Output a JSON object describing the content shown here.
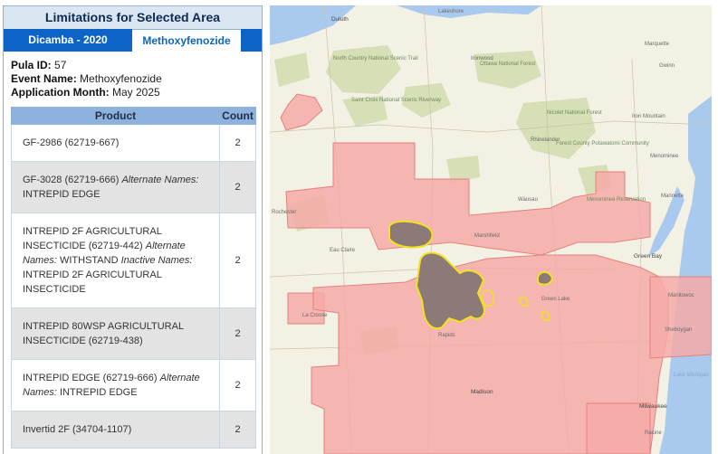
{
  "panel": {
    "title": "Limitations for Selected Area",
    "tabs": [
      {
        "label": "Dicamba - 2020",
        "active": false
      },
      {
        "label": "Methoxyfenozide",
        "active": true
      }
    ],
    "pula_id_label": "Pula ID:",
    "pula_id": "57",
    "event_name_label": "Event Name:",
    "event_name": "Methoxyfenozide",
    "app_month_label": "Application Month:",
    "app_month": "May 2025",
    "table": {
      "headers": [
        "Product",
        "Count"
      ],
      "rows": [
        {
          "name": "GF-2986 (62719-667)",
          "count": "2"
        },
        {
          "name": "GF-3028 (62719-666)",
          "alt_label": "Alternate Names:",
          "alt": "INTREPID EDGE",
          "count": "2"
        },
        {
          "name": "INTREPID 2F AGRICULTURAL INSECTICIDE (62719-442)",
          "alt_label": "Alternate Names:",
          "alt": "WITHSTAND",
          "inactive_label": "Inactive Names:",
          "inactive": "INTREPID 2F AGRICULTURAL INSECTICIDE",
          "count": "2"
        },
        {
          "name": "INTREPID 80WSP AGRICULTURAL INSECTICIDE (62719-438)",
          "count": "2"
        },
        {
          "name": "INTREPID EDGE (62719-666)",
          "alt_label": "Alternate Names:",
          "alt": "INTREPID EDGE",
          "count": "2"
        },
        {
          "name": "Invertid 2F (34704-1107)",
          "count": "2"
        }
      ]
    }
  },
  "map": {
    "colors": {
      "base": "#f2f1e4",
      "forest": "#d6dfb6",
      "water": "#a9c9ee",
      "limitation_area": "#f6aaa8",
      "limitation_border": "#e5817e",
      "core_fill": "#8c7a78",
      "core_outline": "#f2e21e"
    },
    "labels": {
      "duluth": "Duluth",
      "lakeshore": "Lakeshore",
      "marquette": "Marquette",
      "gwinn": "Gwinn",
      "ottawa_nf": "Ottawa National Forest",
      "north_country_trail": "North Country National Scenic Trail",
      "ironwood": "Ironwood",
      "iron_mountain": "Iron Mountain",
      "nicolet_nf": "Nicolet National Forest",
      "rhinelander": "Rhinelander",
      "forest_county": "Forest County Potawatomi Community",
      "saint_croix": "Saint Croix National Scenic Riverway",
      "menominee": "Menominee",
      "wausau": "Wausau",
      "menominee_res": "Menominee Reservation",
      "marinette": "Marinette",
      "green_bay": "Green Bay",
      "marshfield": "Marshfield",
      "la_crosse": "La Crosse",
      "eau_claire": "Eau Claire",
      "rochester": "Rochester",
      "lake_michigan": "Lake Michigan",
      "milwaukee": "Milwaukee",
      "racine": "Racine",
      "madison": "Madison",
      "green_lake": "Green Lake",
      "rapids": "Rapids",
      "sheboygan": "Sheboygan",
      "manitowoc": "Manitowoc"
    }
  }
}
